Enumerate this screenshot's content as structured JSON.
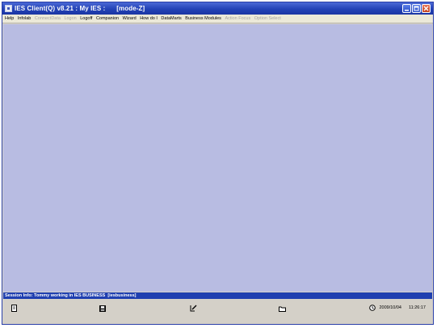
{
  "window": {
    "title": "IES Client(Q) v8.21 : My IES :      [mode-Z]"
  },
  "menu": {
    "items": [
      {
        "label": "Help",
        "enabled": true
      },
      {
        "label": "Infolab",
        "enabled": true
      },
      {
        "label": "ConnectData",
        "enabled": false
      },
      {
        "label": "Logon",
        "enabled": false
      },
      {
        "label": "Logoff",
        "enabled": true
      },
      {
        "label": "Companion",
        "enabled": true
      },
      {
        "label": "Wizard",
        "enabled": true
      },
      {
        "label": "How do I",
        "enabled": true
      },
      {
        "label": "DataMarts",
        "enabled": true
      },
      {
        "label": "Business Modules",
        "enabled": true
      },
      {
        "label": "Action Focus",
        "enabled": false
      },
      {
        "label": "Option Select",
        "enabled": false
      }
    ]
  },
  "status": {
    "session_info": "Session Info: Tommy working in IES BUSINESS  [iesbusiness]"
  },
  "toolbar": {
    "date": "2009/10/04",
    "time": "11:26:17"
  },
  "colors": {
    "title_bar": "#2342b6",
    "workspace": "#b8bce2",
    "status_bar": "#1f3fb0",
    "menu_bar": "#ece9d8"
  }
}
